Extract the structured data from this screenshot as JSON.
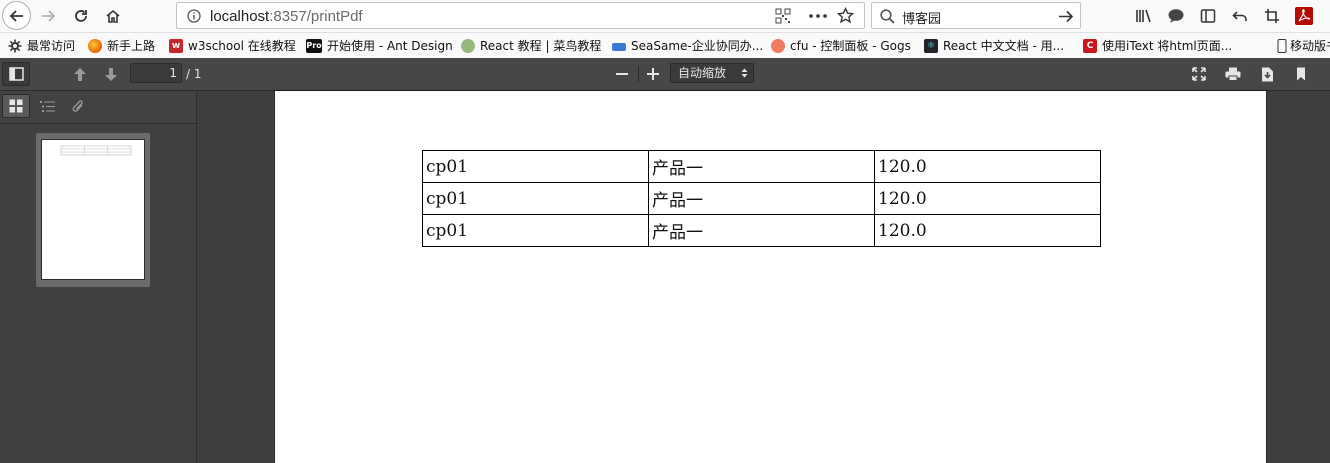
{
  "browser": {
    "url_host": "localhost",
    "url_path": ":8357/printPdf",
    "search_text": "博客园"
  },
  "bookmarks": [
    {
      "label": "最常访问",
      "icon": "gear-icon"
    },
    {
      "label": "新手上路",
      "icon": "firefox-icon"
    },
    {
      "label": "w3school 在线教程",
      "icon": "w3school-icon"
    },
    {
      "label": "开始使用 - Ant Design",
      "icon": "pro-icon",
      "badge": "Pro"
    },
    {
      "label": "React 教程 | 菜鸟教程",
      "icon": "runoob-icon"
    },
    {
      "label": "SeaSame-企业协同办...",
      "icon": "seasame-icon"
    },
    {
      "label": "cfu - 控制面板 - Gogs",
      "icon": "gogs-icon"
    },
    {
      "label": "React 中文文档 - 用...",
      "icon": "react-icon"
    },
    {
      "label": "使用iText 将html页面...",
      "icon": "csdn-icon",
      "badge": "C"
    },
    {
      "label": "移动版书",
      "icon": "mobile-icon"
    }
  ],
  "pdf_viewer": {
    "page_number": "1",
    "page_count": "/ 1",
    "zoom_label": "自动缩放"
  },
  "table": {
    "rows": [
      [
        "cp01",
        "产品一",
        "120.0"
      ],
      [
        "cp01",
        "产品一",
        "120.0"
      ],
      [
        "cp01",
        "产品一",
        "120.0"
      ]
    ]
  },
  "colors": {
    "toolbar": "#474747",
    "viewer_bg": "#3e3e3e",
    "sidebar": "#404040"
  }
}
